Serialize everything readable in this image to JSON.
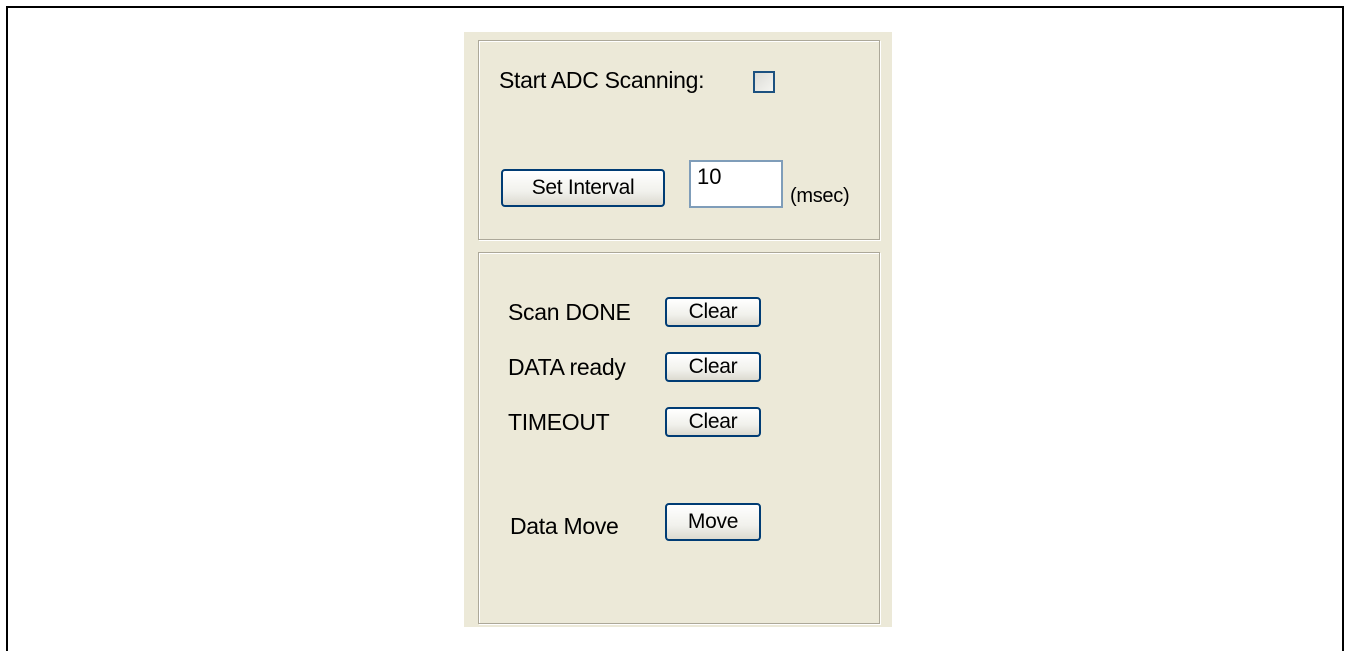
{
  "scanning": {
    "start_label": "Start ADC Scanning:",
    "checked": false
  },
  "interval": {
    "button_label": "Set Interval",
    "value": "10",
    "unit_label": "(msec)"
  },
  "status": {
    "rows": [
      {
        "label": "Scan DONE",
        "button_label": "Clear"
      },
      {
        "label": "DATA ready",
        "button_label": "Clear"
      },
      {
        "label": "TIMEOUT",
        "button_label": "Clear"
      }
    ],
    "move": {
      "label": "Data Move",
      "button_label": "Move"
    }
  },
  "colors": {
    "panel_bg": "#ece9d8",
    "button_border": "#003c74",
    "checkbox_border": "#1c5180",
    "textbox_border": "#7f9db9"
  }
}
